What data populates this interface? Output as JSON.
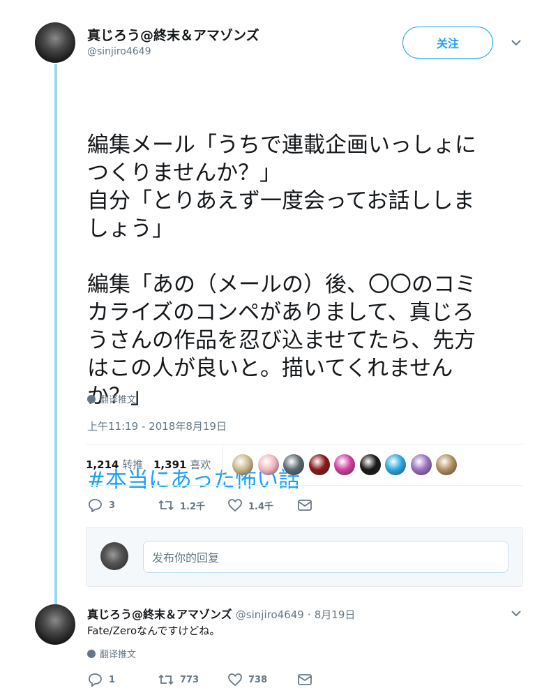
{
  "tweet": {
    "author_name": "真じろう@終末＆アマゾンズ",
    "author_handle": "@sinjiro4649",
    "follow_label": "关注",
    "body_text": "編集メール「うちで連載企画いっしょに\nつくりませんか？」\n自分「とりあえず一度会ってお話ししま\nしょう」\n\n編集「あの（メールの）後、〇〇のコミ\nカライズのコンペがありまして、真じろ\nうさんの作品を忍び込ませてたら、先方\nはこの人が良いと。描いてくれません\nか？」",
    "hashtag": "#本当にあった怖い話",
    "translate_label": "翻译推文",
    "timestamp": "上午11:19 - 2018年8月19日",
    "retweets_count": "1,214",
    "retweets_label": "转推",
    "likes_count": "1,391",
    "likes_label": "喜欢",
    "reply_count": "3",
    "retweet_action_count": "1.2千",
    "like_action_count": "1.4千"
  },
  "likers": [
    {
      "color": "#c9b88a"
    },
    {
      "color": "#f0b8c0"
    },
    {
      "color": "#5a6a70"
    },
    {
      "color": "#8a1818"
    },
    {
      "color": "#d040a0"
    },
    {
      "color": "#181818"
    },
    {
      "color": "#2aa8e0"
    },
    {
      "color": "#9a70c0"
    },
    {
      "color": "#b09060"
    }
  ],
  "reply_composer": {
    "placeholder": "发布你的回复"
  },
  "reply_tweet": {
    "author_name": "真じろう@終末＆アマゾンズ",
    "author_handle": "@sinjiro4649",
    "separator": "·",
    "date": "8月19日",
    "text": "Fate/Zeroなんですけどね。",
    "translate_label": "翻译推文",
    "reply_count": "1",
    "retweet_count": "773",
    "like_count": "738"
  },
  "colors": {
    "accent": "#1da1f2",
    "thread_line": "#9ad7f2",
    "muted": "#657786"
  }
}
